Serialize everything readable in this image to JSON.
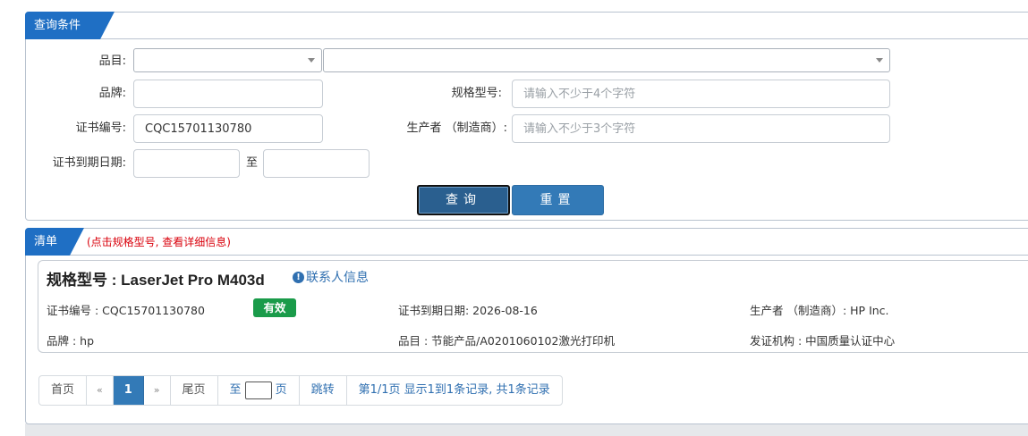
{
  "query_panel": {
    "title": "查询条件",
    "category_label": "品目:",
    "brand_label": "品牌:",
    "model_label": "规格型号:",
    "model_placeholder": "请输入不少于4个字符",
    "cert_no_label": "证书编号:",
    "cert_no_value": "CQC15701130780",
    "manufacturer_label": "生产者 （制造商）:",
    "manufacturer_placeholder": "请输入不少于3个字符",
    "expiry_label": "证书到期日期:",
    "to_label": "至",
    "search_button": "查询",
    "reset_button": "重置"
  },
  "list_panel": {
    "title": "清单",
    "tip": "(点击规格型号, 查看详细信息)",
    "result": {
      "model_title": "规格型号 : LaserJet Pro M403d",
      "contact_link": "联系人信息",
      "cert_no": "证书编号 : CQC15701130780",
      "status": "有效",
      "expiry": "证书到期日期: 2026-08-16",
      "manufacturer": "生产者 （制造商）: HP Inc.",
      "brand": "品牌 : hp",
      "category": "品目 : 节能产品/A0201060102激光打印机",
      "issuer": "发证机构 : 中国质量认证中心"
    }
  },
  "pagination": {
    "first": "首页",
    "prev": "«",
    "current": "1",
    "next": "»",
    "last": "尾页",
    "goto_prefix": "至",
    "goto_suffix": "页",
    "jump": "跳转",
    "summary": "第1/1页  显示1到1条记录, 共1条记录"
  },
  "colors": {
    "accent": "#1f6fc4",
    "button": "#337ab7",
    "tip": "#d9000b",
    "status_valid": "#1a9b4a"
  }
}
